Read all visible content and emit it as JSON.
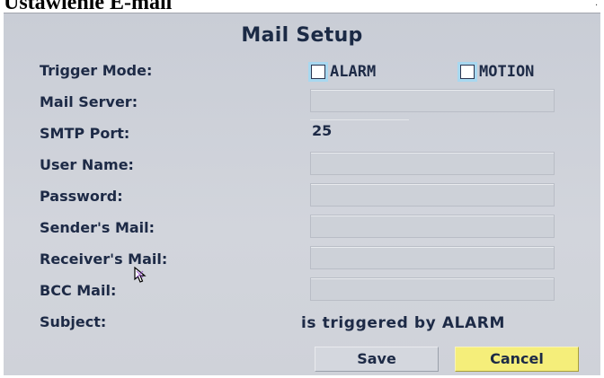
{
  "heading": "Ustawienie E-mail",
  "dialog": {
    "title": "Mail Setup",
    "trigger_mode": {
      "label": "Trigger Mode:",
      "options": [
        {
          "label": "ALARM",
          "checked": false
        },
        {
          "label": "MOTION",
          "checked": false
        }
      ]
    },
    "fields": {
      "mail_server": {
        "label": "Mail Server:",
        "value": ""
      },
      "smtp_port": {
        "label": "SMTP Port:",
        "value": "25"
      },
      "user_name": {
        "label": "User Name:",
        "value": ""
      },
      "password": {
        "label": "Password:",
        "value": ""
      },
      "sender_mail": {
        "label": "Sender's Mail:",
        "value": ""
      },
      "receiver_mail": {
        "label": "Receiver's Mail:",
        "value": ""
      },
      "bcc_mail": {
        "label": "BCC Mail:",
        "value": ""
      },
      "subject": {
        "label": "Subject:",
        "value": "is triggered by ALARM"
      }
    },
    "buttons": {
      "save": "Save",
      "cancel": "Cancel"
    },
    "colors": {
      "panel": "#cfd2d9",
      "text": "#1d2a46",
      "cancel_highlight": "#f5ee7a",
      "checkbox_glow": "#a8d8f0"
    }
  }
}
